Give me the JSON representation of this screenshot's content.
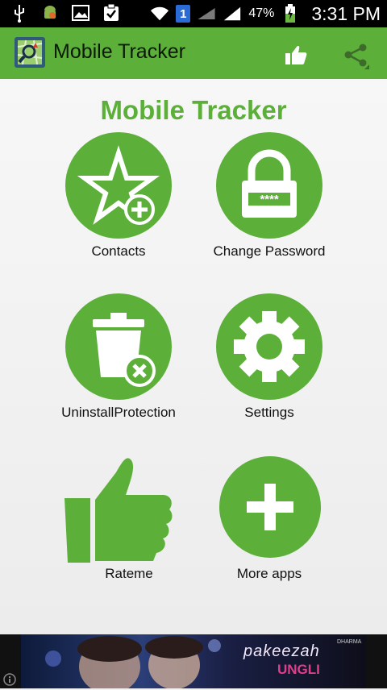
{
  "status_bar": {
    "left_icons": [
      "usb-icon",
      "android-icon",
      "image-icon",
      "clipboard-icon"
    ],
    "notification_count": "1",
    "battery_percent": "47%",
    "time": "3:31 PM"
  },
  "app_bar": {
    "title": "Mobile Tracker",
    "actions": [
      "thumbs-up-icon",
      "share-icon"
    ]
  },
  "heading": "Mobile Tracker",
  "tiles": [
    {
      "label": "Contacts",
      "icon": "star-plus-icon"
    },
    {
      "label": "Change Password",
      "icon": "lock-icon",
      "secret": "****"
    },
    {
      "label": "UninstallProtection",
      "icon": "trash-delete-icon"
    },
    {
      "label": "Settings",
      "icon": "gear-icon"
    },
    {
      "label": "Rateme",
      "icon": "thumbs-up-icon"
    },
    {
      "label": "More apps",
      "icon": "plus-icon"
    }
  ],
  "ad": {
    "title": "pakeezah",
    "subtitle": "UNGLI",
    "brand": "DHARMA"
  },
  "colors": {
    "accent": "#5cb03a",
    "status_bar": "#000000"
  }
}
